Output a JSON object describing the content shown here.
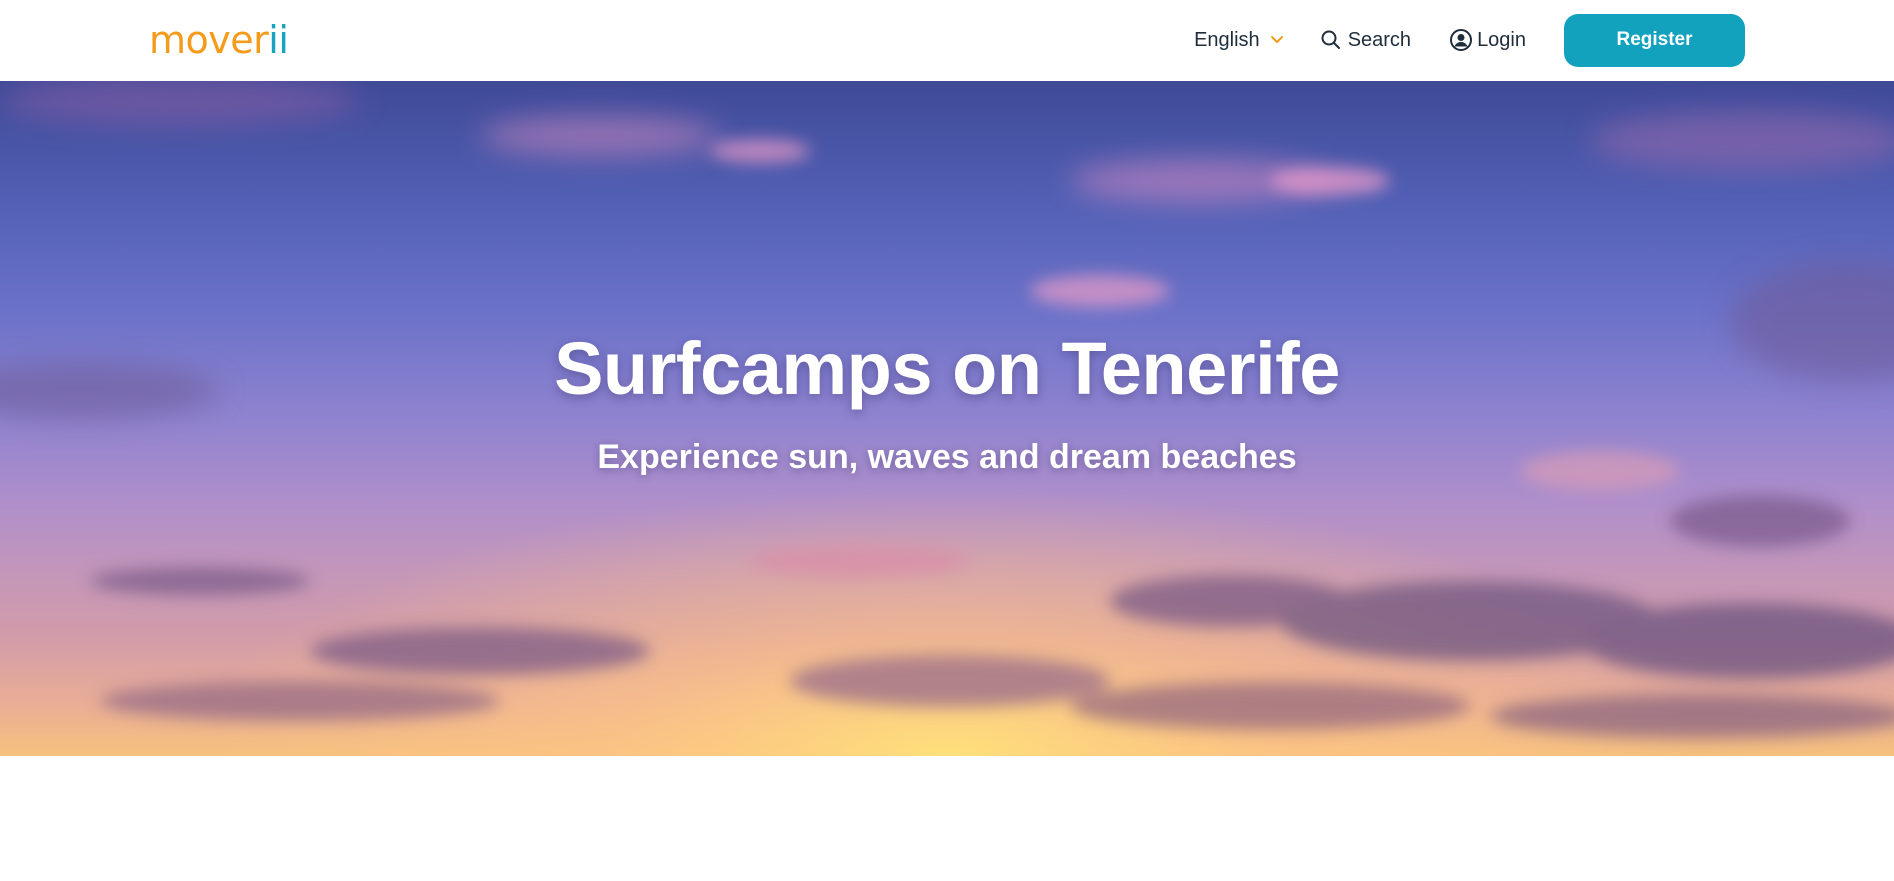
{
  "header": {
    "logo_main": "mover",
    "logo_accent": "ii",
    "language_label": "English",
    "search_label": "Search",
    "login_label": "Login",
    "register_label": "Register"
  },
  "hero": {
    "title": "Surfcamps on Tenerife",
    "subtitle": "Experience sun, waves and dream beaches"
  },
  "colors": {
    "brand_orange": "#f59b1c",
    "brand_teal": "#13a2bd",
    "text_dark": "#1f2d3d"
  },
  "icons": {
    "language": "chevron-down-icon",
    "search": "search-icon",
    "login": "user-circle-icon"
  }
}
